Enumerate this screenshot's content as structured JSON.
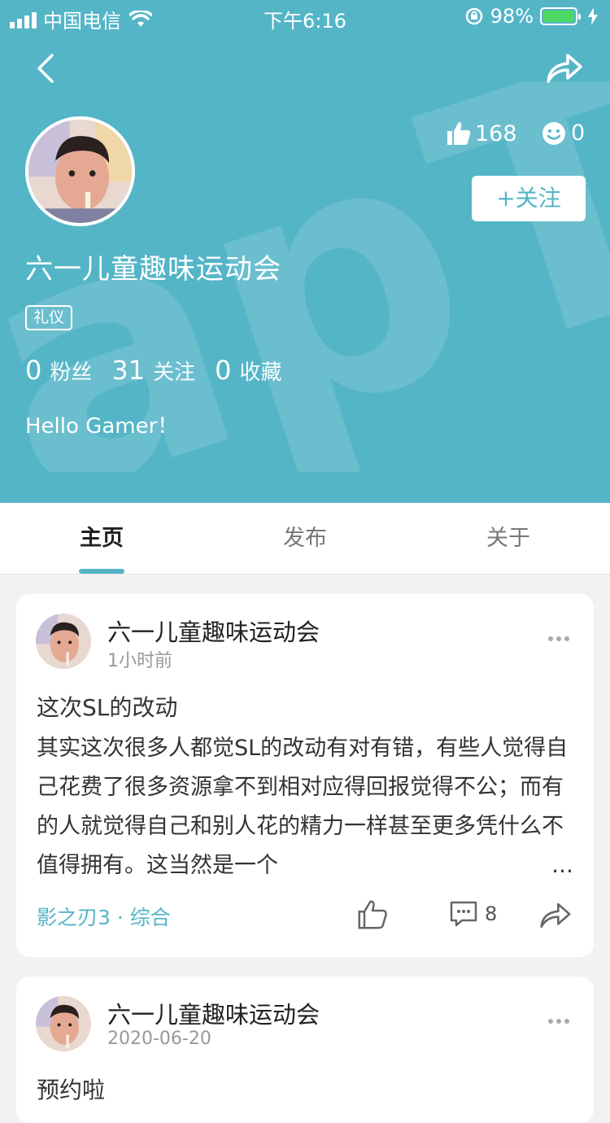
{
  "status_bar": {
    "carrier": "中国电信",
    "time": "下午6:16",
    "battery": "98%"
  },
  "profile": {
    "name": "六一儿童趣味运动会",
    "tag": "礼仪",
    "likes": "168",
    "emoji_count": "0",
    "follow_label": "+关注",
    "stats": [
      {
        "value": "0",
        "label": "粉丝"
      },
      {
        "value": "31",
        "label": "关注"
      },
      {
        "value": "0",
        "label": "收藏"
      }
    ],
    "bio": "Hello Gamer！"
  },
  "tabs": [
    {
      "label": "主页",
      "active": true
    },
    {
      "label": "发布",
      "active": false
    },
    {
      "label": "关于",
      "active": false
    }
  ],
  "posts": [
    {
      "author": "六一儿童趣味运动会",
      "time": "1小时前",
      "title": "这次SL的改动",
      "body": "其实这次很多人都觉SL的改动有对有错，有些人觉得自己花费了很多资源拿不到相对应得回报觉得不公；而有的人就觉得自己和别人花的精力一样甚至更多凭什么不值得拥有。这当然是一个",
      "ellipsis": "…",
      "game_tag": "影之刃3 · 综合",
      "comments": "8"
    },
    {
      "author": "六一儿童趣味运动会",
      "time": "2020-06-20",
      "title": "预约啦"
    }
  ],
  "colors": {
    "brand": "#54b5c7",
    "battery": "#4cd964"
  },
  "icons": [
    "signal-icon",
    "wifi-icon",
    "rotation-lock-icon",
    "battery-icon",
    "charging-icon",
    "back-icon",
    "share-icon",
    "thumbs-up-icon",
    "smile-icon",
    "more-icon",
    "comment-icon"
  ]
}
